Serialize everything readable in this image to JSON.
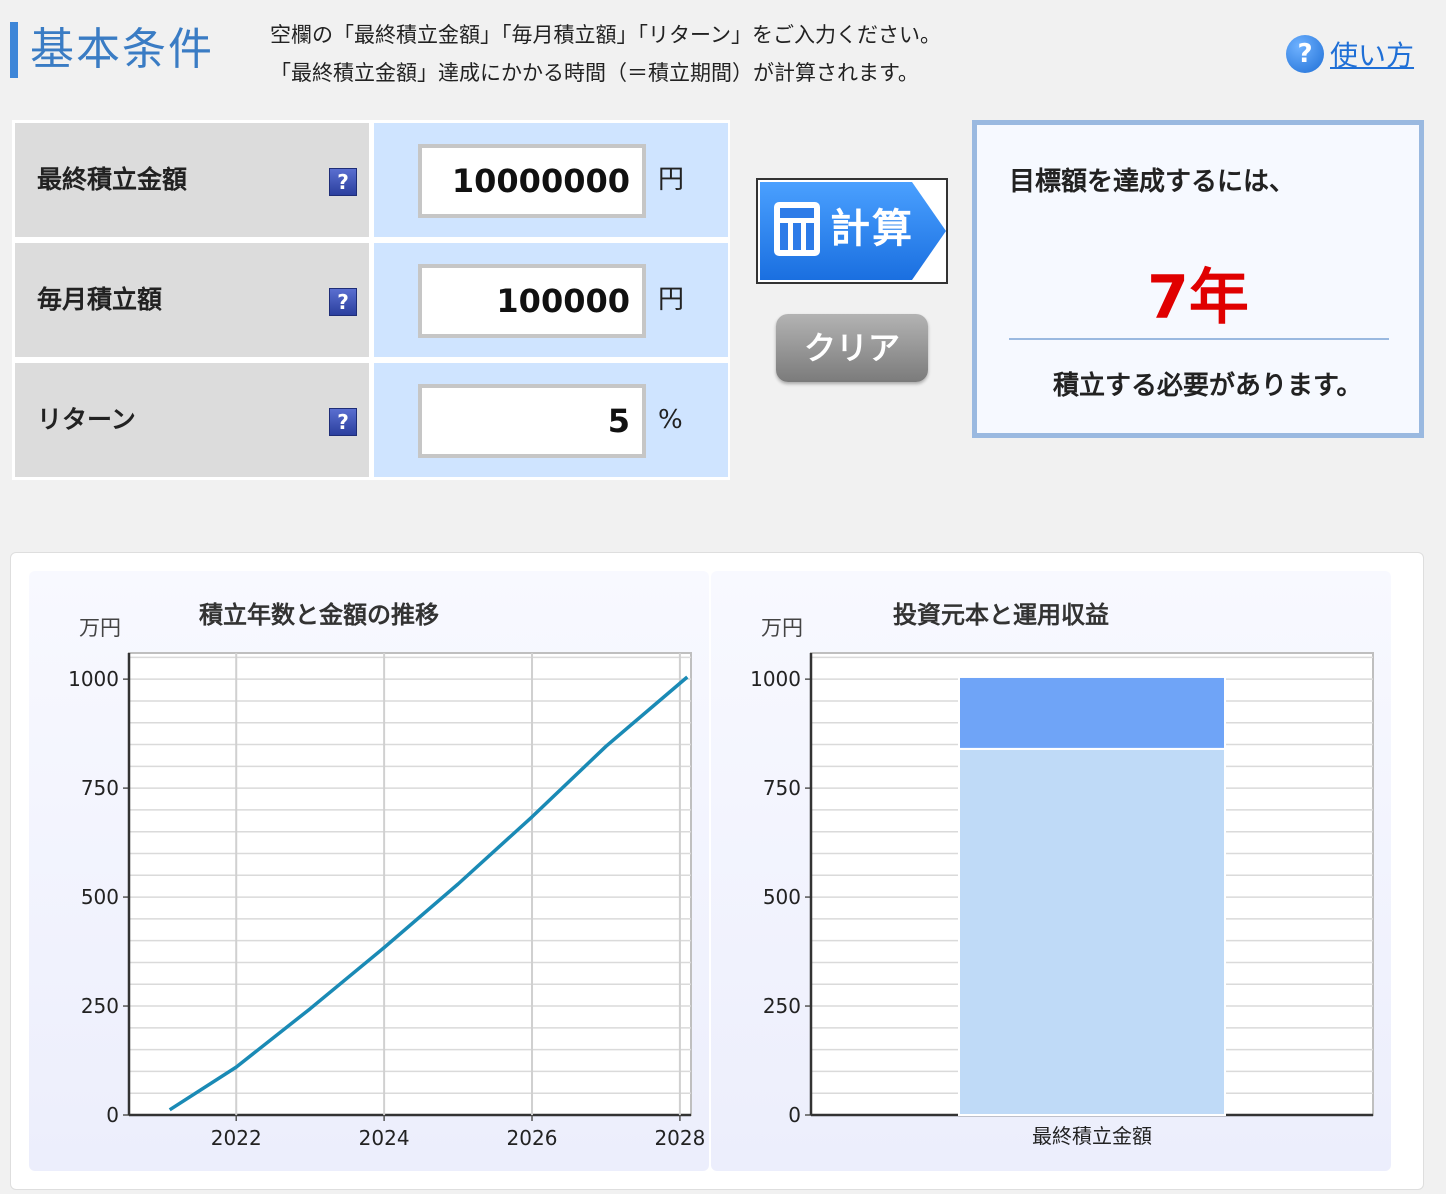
{
  "header": {
    "title": "基本条件",
    "instructions_line1": "空欄の「最終積立金額」「毎月積立額」「リターン」をご入力ください。",
    "instructions_line2": "「最終積立金額」達成にかかる時間（＝積立期間）が計算されます。",
    "help_label": "使い方",
    "help_icon": "?"
  },
  "form": {
    "rows": [
      {
        "label": "最終積立金額",
        "value": "10000000",
        "unit": "円",
        "help_icon": "?"
      },
      {
        "label": "毎月積立額",
        "value": "100000",
        "unit": "円",
        "help_icon": "?"
      },
      {
        "label": "リターン",
        "value": "5",
        "unit": "%",
        "help_icon": "?"
      }
    ]
  },
  "buttons": {
    "calculate": "計算",
    "clear": "クリア"
  },
  "result": {
    "lead": "目標額を達成するには、",
    "value": "7年",
    "tail": "積立する必要があります。"
  },
  "colors": {
    "accent": "#3d86d8",
    "result_red": "#e00000",
    "line": "#1a8ab5",
    "principal": "#bfdaf7",
    "gain": "#6fa4f7",
    "input_bg": "#cfe4ff"
  },
  "chart_data": [
    {
      "type": "line",
      "title": "積立年数と金額の推移",
      "unit_label": "万円",
      "x": [
        2021.1,
        2022,
        2023,
        2024,
        2025,
        2026,
        2027,
        2028.1
      ],
      "y": [
        12,
        110,
        244,
        384,
        530,
        684,
        846,
        1005
      ],
      "xticks": [
        "2022",
        "2024",
        "2026",
        "2028"
      ],
      "yticks": [
        0,
        250,
        500,
        750,
        1000
      ],
      "xlim": [
        2020.55,
        2028.15
      ],
      "ylim": [
        0,
        1060
      ],
      "grid": true
    },
    {
      "type": "bar",
      "title": "投資元本と運用収益",
      "unit_label": "万円",
      "categories": [
        "最終積立金額"
      ],
      "series": [
        {
          "values": [
            840
          ]
        },
        {
          "values": [
            165
          ]
        }
      ],
      "stacked": true,
      "yticks": [
        0,
        250,
        500,
        750,
        1000
      ],
      "ylim": [
        0,
        1060
      ],
      "grid": true
    }
  ]
}
